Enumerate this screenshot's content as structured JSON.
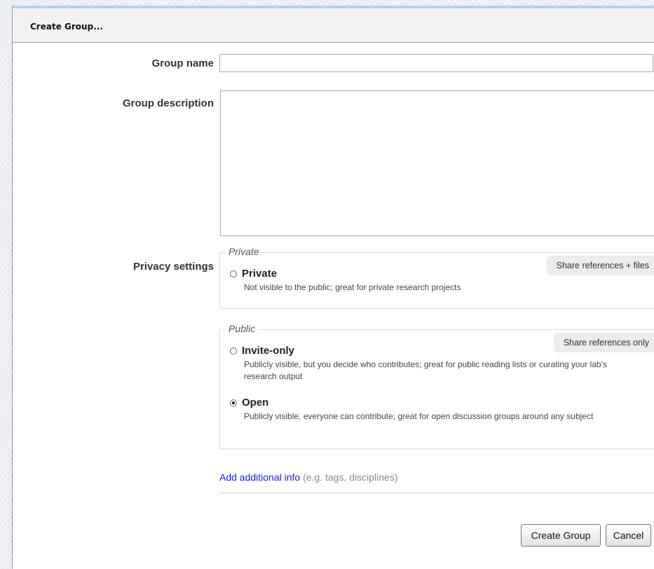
{
  "dialog": {
    "title": "Create Group..."
  },
  "form": {
    "group_name_label": "Group name",
    "group_name_value": "",
    "group_description_label": "Group description",
    "group_description_value": "",
    "privacy_label": "Privacy settings"
  },
  "privacy": {
    "private_group": {
      "legend": "Private",
      "tag": "Share references + files",
      "options": [
        {
          "label": "Private",
          "description": "Not visible to the public; great for private research projects",
          "checked": false
        }
      ]
    },
    "public_group": {
      "legend": "Public",
      "tag": "Share references only",
      "options": [
        {
          "label": "Invite-only",
          "description": "Publicly visible, but you decide who contributes; great for public reading lists or curating your lab's research output",
          "checked": false
        },
        {
          "label": "Open",
          "description": "Publicly visible, everyone can contribute; great for open discussion groups around any subject",
          "checked": true
        }
      ]
    }
  },
  "additional_info": {
    "link": "Add additional info",
    "hint": "(e.g. tags, disciplines)"
  },
  "buttons": {
    "create": "Create Group",
    "cancel": "Cancel"
  },
  "colors": {
    "link": "#1a1aee",
    "header_accent": "#bcd0ea"
  }
}
